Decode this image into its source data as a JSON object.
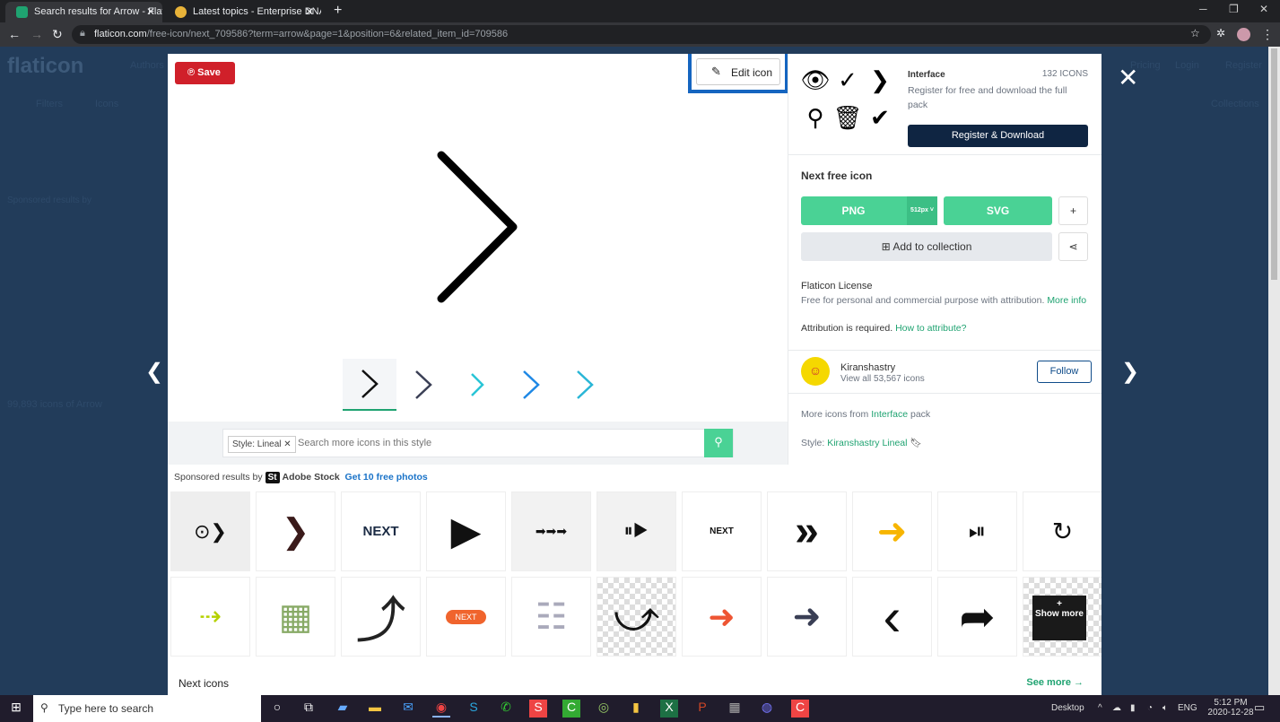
{
  "browser": {
    "tabs": [
      {
        "title": "Search results for Arrow - Flaticon",
        "active": true
      },
      {
        "title": "Latest topics - Enterprise DNA Forum",
        "active": false
      }
    ],
    "url_domain": "flaticon.com",
    "url_path": "/free-icon/next_709586?term=arrow&page=1&position=6&related_item_id=709586"
  },
  "background": {
    "logo": "flaticon",
    "nav": [
      "Authors",
      "Pricing",
      "Login",
      "Register"
    ],
    "filters": "Filters",
    "icons_dropdown": "Icons",
    "collections": "Collections",
    "results_count": "99,893 icons of Arrow",
    "sponsored": "Sponsored results by"
  },
  "modal": {
    "save_label": "Save",
    "edit_label": "Edit icon",
    "variants": [
      "#111111",
      "#3a3f55",
      "#29c5d6",
      "#1e88e5",
      "#29b6d6"
    ],
    "search": {
      "chip": "Style: Lineal",
      "placeholder": "Search more icons in this style"
    },
    "pack": {
      "name": "Interface",
      "count": "132 ICONS",
      "desc": "Register for free and download the full pack",
      "register": "Register & Download"
    },
    "next_free": "Next free icon",
    "png_label": "PNG",
    "png_size": "512px",
    "svg_label": "SVG",
    "plus": "+",
    "add_collection": "Add to collection",
    "license_title": "Flaticon License",
    "license_text": "Free for personal and commercial purpose with attribution.",
    "more_info": "More info",
    "attribution": "Attribution is required.",
    "how_attribute": "How to attribute?",
    "author": {
      "name": "Kiranshastry",
      "count": "View all 53,567 icons",
      "follow": "Follow"
    },
    "more_from": "More icons from",
    "more_from_link": "Interface",
    "more_from_suffix": "pack",
    "style_label": "Style:",
    "style_link": "Kiranshastry Lineal",
    "sponsored": {
      "label": "Sponsored results by",
      "brand": "Adobe Stock",
      "brand_logo": "St",
      "cta": "Get 10 free photos"
    },
    "thumbs": [
      "⊙❯",
      "❯",
      "NEXT",
      "▶",
      "➡➡➡",
      "⏸▶",
      "NEXT",
      "»",
      "➜",
      "⏯",
      "↻",
      "⇢",
      "▦",
      "⤴",
      "NEXT",
      "☷",
      "⤻",
      "➜",
      "➜",
      "‹",
      "➦",
      "Show more"
    ],
    "show_more": "Show more",
    "next_icons": "Next icons",
    "see_more": "See more →"
  },
  "taskbar": {
    "search_placeholder": "Type here to search",
    "desktop": "Desktop",
    "lang": "ENG",
    "time": "5:12 PM",
    "date": "2020-12-28"
  }
}
